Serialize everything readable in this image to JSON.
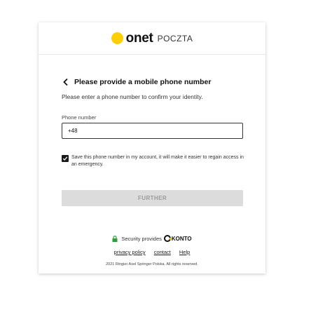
{
  "brand": {
    "name": "onet",
    "product": "POCZTA",
    "accent_color": "#ffce00"
  },
  "form": {
    "title": "Please provide a mobile phone number",
    "subtitle": "Please enter a phone number to confirm your identity.",
    "phone_label": "Phone number",
    "phone_value": "+48",
    "save_checkbox_checked": true,
    "save_checkbox_label": "Save this phone number in my account, it will make it easier to regain access in an emergency.",
    "further_label": "FURTHER"
  },
  "footer": {
    "security_text": "Security provides",
    "security_brand": "KONTO",
    "links": [
      "privacy policy",
      "contact",
      "Help"
    ],
    "copyright": "2021 Ringier Axel Springer Polska. All rights reserved."
  }
}
